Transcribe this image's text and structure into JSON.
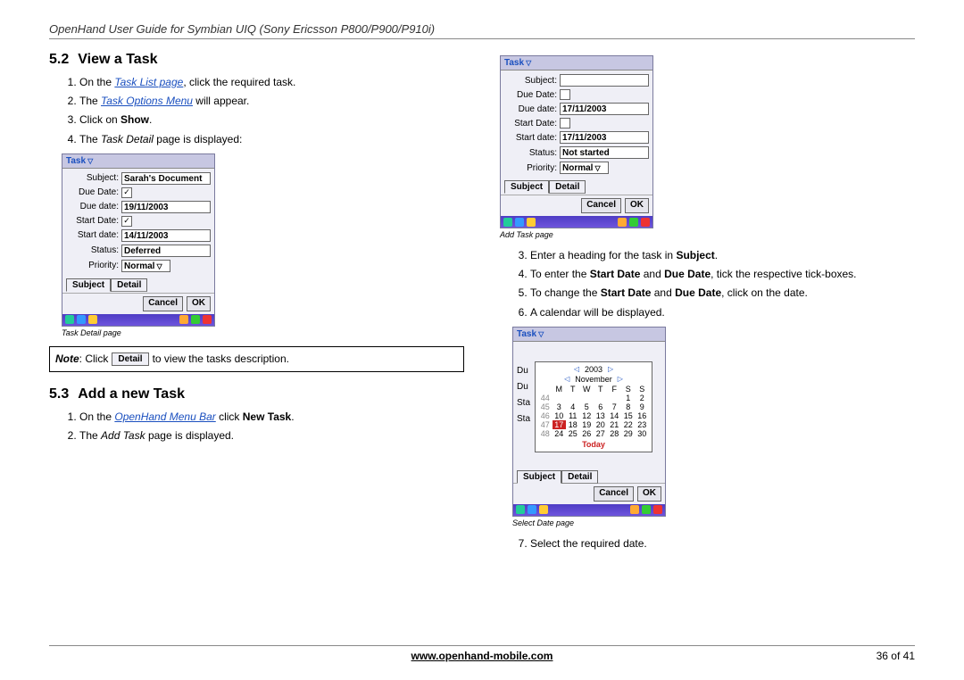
{
  "header": "OpenHand User Guide for Symbian UIQ (Sony Ericsson P800/P900/P910i)",
  "sec52": {
    "num": "5.2",
    "title": "View a Task"
  },
  "sec53": {
    "num": "5.3",
    "title": "Add a new Task"
  },
  "s52": {
    "s1a": "On the ",
    "s1link": "Task List page",
    "s1b": ", click the required task.",
    "s2a": "The ",
    "s2link": "Task Options Menu",
    "s2b": " will appear.",
    "s3a": "Click on ",
    "s3b": "Show",
    "s3c": ".",
    "s4a": "The ",
    "s4b": "Task Detail",
    "s4c": " page is displayed:"
  },
  "phone1": {
    "menu": "Task",
    "subject_lbl": "Subject:",
    "subject_val": "Sarah's Document",
    "duedate_lbl": "Due Date:",
    "duedate_val_lbl": "Due date:",
    "duedate_val": "19/11/2003",
    "startdate_lbl": "Start Date:",
    "startdate_val_lbl": "Start date:",
    "startdate_val": "14/11/2003",
    "status_lbl": "Status:",
    "status_val": "Deferred",
    "priority_lbl": "Priority:",
    "priority_val": "Normal",
    "tab_subject": "Subject",
    "tab_detail": "Detail",
    "btn_cancel": "Cancel",
    "btn_ok": "OK",
    "caption": "Task Detail page"
  },
  "note": {
    "bold": "Note",
    "a": ": Click ",
    "btn": "Detail",
    "b": " to view the tasks description."
  },
  "s53": {
    "s1a": "On the ",
    "s1link": "OpenHand Menu Bar",
    "s1b": " click ",
    "s1c": "New Task",
    "s1d": ".",
    "s2a": "The ",
    "s2b": "Add Task",
    "s2c": " page is displayed."
  },
  "phone2": {
    "menu": "Task",
    "subject_lbl": "Subject:",
    "subject_val": "",
    "duedate_lbl": "Due Date:",
    "duedate_val_lbl": "Due date:",
    "duedate_val": "17/11/2003",
    "startdate_lbl": "Start Date:",
    "startdate_val_lbl": "Start date:",
    "startdate_val": "17/11/2003",
    "status_lbl": "Status:",
    "status_val": "Not started",
    "priority_lbl": "Priority:",
    "priority_val": "Normal",
    "tab_subject": "Subject",
    "tab_detail": "Detail",
    "btn_cancel": "Cancel",
    "btn_ok": "OK",
    "caption": "Add Task page"
  },
  "s53right": {
    "s3a": "Enter a heading for the task in ",
    "s3b": "Subject",
    "s3c": ".",
    "s4a": "To enter the ",
    "s4b": "Start Date",
    "s4c": " and ",
    "s4d": "Due Date",
    "s4e": ", tick the respective tick-boxes.",
    "s5a": "To change the ",
    "s5b": "Start Date",
    "s5c": " and ",
    "s5d": "Due Date",
    "s5e": ", click on the date.",
    "s6": "A calendar will be displayed.",
    "s7": "Select the required date."
  },
  "calendar": {
    "menu": "Task",
    "year": "2003",
    "month": "November",
    "dow": [
      "M",
      "T",
      "W",
      "T",
      "F",
      "S",
      "S"
    ],
    "weeks": [
      {
        "wk": "44",
        "d": [
          "",
          "",
          "",
          "",
          "",
          "1",
          "2"
        ]
      },
      {
        "wk": "45",
        "d": [
          "3",
          "4",
          "5",
          "6",
          "7",
          "8",
          "9"
        ]
      },
      {
        "wk": "46",
        "d": [
          "10",
          "11",
          "12",
          "13",
          "14",
          "15",
          "16"
        ]
      },
      {
        "wk": "47",
        "d": [
          "17",
          "18",
          "19",
          "20",
          "21",
          "22",
          "23"
        ]
      },
      {
        "wk": "48",
        "d": [
          "24",
          "25",
          "26",
          "27",
          "28",
          "29",
          "30"
        ]
      }
    ],
    "selected": "17",
    "today": "Today",
    "tab_subject": "Subject",
    "tab_detail": "Detail",
    "btn_cancel": "Cancel",
    "btn_ok": "OK",
    "caption": "Select Date page",
    "side_labels": [
      "Du",
      "Du",
      "Sta",
      "Sta"
    ]
  },
  "footer": {
    "site": "www.openhand-mobile.com",
    "page": "36 of 41"
  }
}
